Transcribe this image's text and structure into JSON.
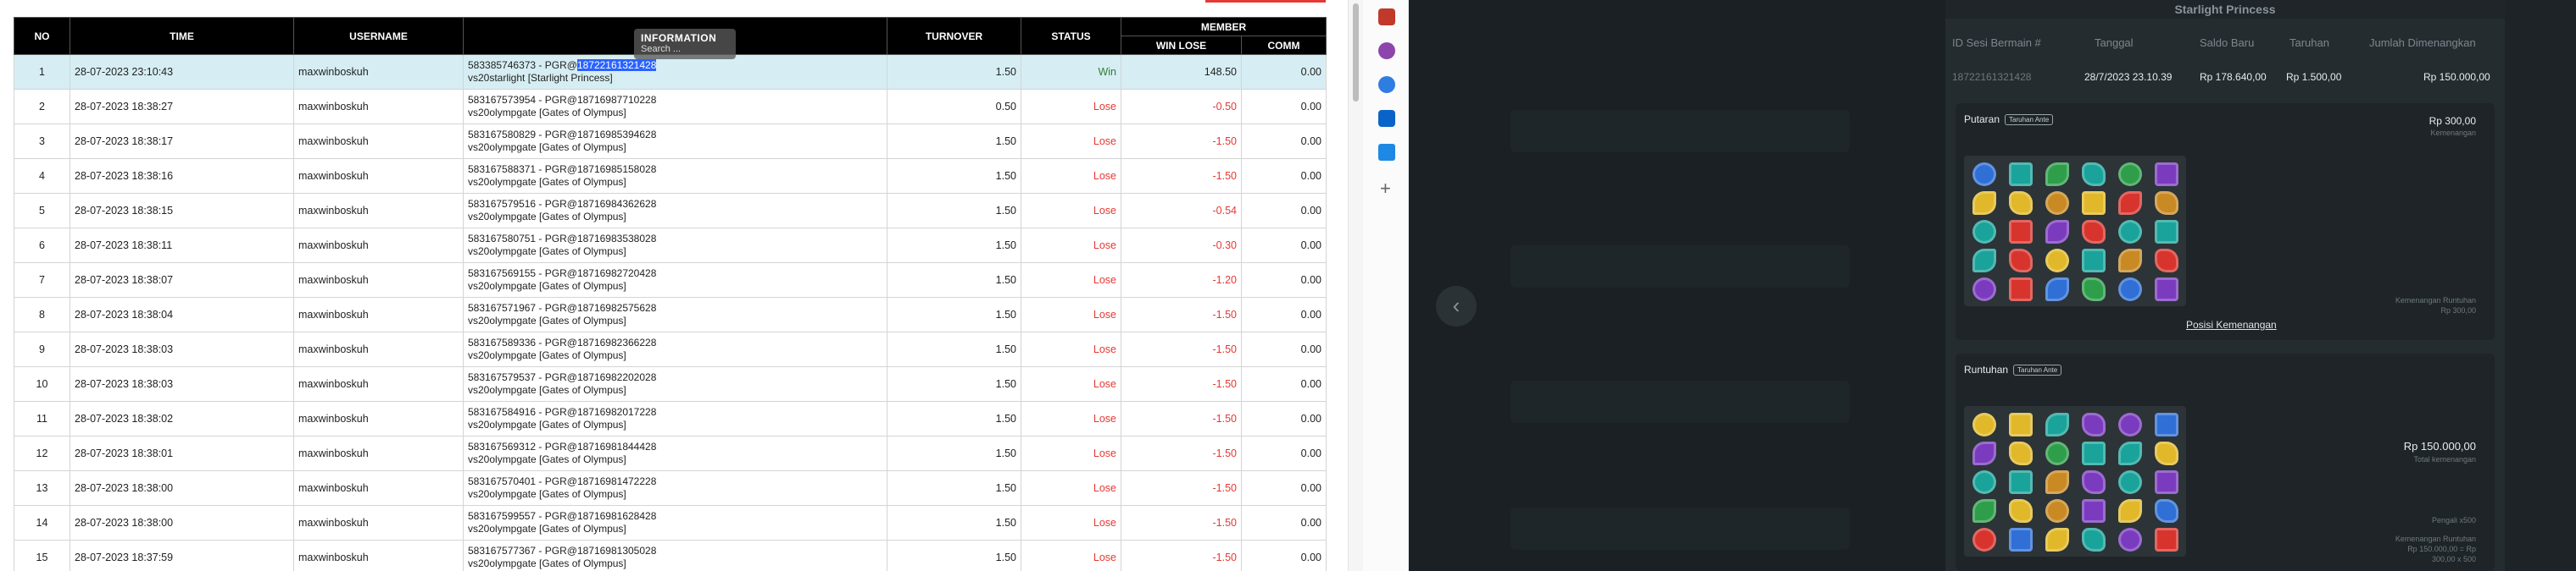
{
  "table": {
    "headers": {
      "no": "NO",
      "time": "TIME",
      "username": "USERNAME",
      "information": "INFORMATION",
      "turnover": "TURNOVER",
      "status": "STATUS",
      "member": "MEMBER",
      "win_lose": "WIN LOSE",
      "comm": "COMM"
    },
    "selected_text": "18722161321428",
    "rows": [
      {
        "no": "1",
        "time": "28-07-2023 23:10:43",
        "username": "maxwinboskuh",
        "info_prefix": "583385746373 - PGR@",
        "info_id": "18722161321428",
        "info_game": "vs20starlight [Starlight Princess]",
        "turnover": "1.50",
        "status": "Win",
        "win_lose": "148.50",
        "comm": "0.00"
      },
      {
        "no": "2",
        "time": "28-07-2023 18:38:27",
        "username": "maxwinboskuh",
        "info_prefix": "583167573954 - PGR@",
        "info_id": "18716987710228",
        "info_game": "vs20olympgate [Gates of Olympus]",
        "turnover": "0.50",
        "status": "Lose",
        "win_lose": "-0.50",
        "comm": "0.00"
      },
      {
        "no": "3",
        "time": "28-07-2023 18:38:17",
        "username": "maxwinboskuh",
        "info_prefix": "583167580829 - PGR@",
        "info_id": "18716985394628",
        "info_game": "vs20olympgate [Gates of Olympus]",
        "turnover": "1.50",
        "status": "Lose",
        "win_lose": "-1.50",
        "comm": "0.00"
      },
      {
        "no": "4",
        "time": "28-07-2023 18:38:16",
        "username": "maxwinboskuh",
        "info_prefix": "583167588371 - PGR@",
        "info_id": "18716985158028",
        "info_game": "vs20olympgate [Gates of Olympus]",
        "turnover": "1.50",
        "status": "Lose",
        "win_lose": "-1.50",
        "comm": "0.00"
      },
      {
        "no": "5",
        "time": "28-07-2023 18:38:15",
        "username": "maxwinboskuh",
        "info_prefix": "583167579516 - PGR@",
        "info_id": "18716984362628",
        "info_game": "vs20olympgate [Gates of Olympus]",
        "turnover": "1.50",
        "status": "Lose",
        "win_lose": "-0.54",
        "comm": "0.00"
      },
      {
        "no": "6",
        "time": "28-07-2023 18:38:11",
        "username": "maxwinboskuh",
        "info_prefix": "583167580751 - PGR@",
        "info_id": "18716983538028",
        "info_game": "vs20olympgate [Gates of Olympus]",
        "turnover": "1.50",
        "status": "Lose",
        "win_lose": "-0.30",
        "comm": "0.00"
      },
      {
        "no": "7",
        "time": "28-07-2023 18:38:07",
        "username": "maxwinboskuh",
        "info_prefix": "583167569155 - PGR@",
        "info_id": "18716982720428",
        "info_game": "vs20olympgate [Gates of Olympus]",
        "turnover": "1.50",
        "status": "Lose",
        "win_lose": "-1.20",
        "comm": "0.00"
      },
      {
        "no": "8",
        "time": "28-07-2023 18:38:04",
        "username": "maxwinboskuh",
        "info_prefix": "583167571967 - PGR@",
        "info_id": "18716982575628",
        "info_game": "vs20olympgate [Gates of Olympus]",
        "turnover": "1.50",
        "status": "Lose",
        "win_lose": "-1.50",
        "comm": "0.00"
      },
      {
        "no": "9",
        "time": "28-07-2023 18:38:03",
        "username": "maxwinboskuh",
        "info_prefix": "583167589336 - PGR@",
        "info_id": "18716982366228",
        "info_game": "vs20olympgate [Gates of Olympus]",
        "turnover": "1.50",
        "status": "Lose",
        "win_lose": "-1.50",
        "comm": "0.00"
      },
      {
        "no": "10",
        "time": "28-07-2023 18:38:03",
        "username": "maxwinboskuh",
        "info_prefix": "583167579537 - PGR@",
        "info_id": "18716982202028",
        "info_game": "vs20olympgate [Gates of Olympus]",
        "turnover": "1.50",
        "status": "Lose",
        "win_lose": "-1.50",
        "comm": "0.00"
      },
      {
        "no": "11",
        "time": "28-07-2023 18:38:02",
        "username": "maxwinboskuh",
        "info_prefix": "583167584916 - PGR@",
        "info_id": "18716982017228",
        "info_game": "vs20olympgate [Gates of Olympus]",
        "turnover": "1.50",
        "status": "Lose",
        "win_lose": "-1.50",
        "comm": "0.00"
      },
      {
        "no": "12",
        "time": "28-07-2023 18:38:01",
        "username": "maxwinboskuh",
        "info_prefix": "583167569312 - PGR@",
        "info_id": "18716981844428",
        "info_game": "vs20olympgate [Gates of Olympus]",
        "turnover": "1.50",
        "status": "Lose",
        "win_lose": "-1.50",
        "comm": "0.00"
      },
      {
        "no": "13",
        "time": "28-07-2023 18:38:00",
        "username": "maxwinboskuh",
        "info_prefix": "583167570401 - PGR@",
        "info_id": "18716981472228",
        "info_game": "vs20olympgate [Gates of Olympus]",
        "turnover": "1.50",
        "status": "Lose",
        "win_lose": "-1.50",
        "comm": "0.00"
      },
      {
        "no": "14",
        "time": "28-07-2023 18:38:00",
        "username": "maxwinboskuh",
        "info_prefix": "583167599557 - PGR@",
        "info_id": "18716981628428",
        "info_game": "vs20olympgate [Gates of Olympus]",
        "turnover": "1.50",
        "status": "Lose",
        "win_lose": "-1.50",
        "comm": "0.00"
      },
      {
        "no": "15",
        "time": "28-07-2023 18:37:59",
        "username": "maxwinboskuh",
        "info_prefix": "583167577367 - PGR@",
        "info_id": "18716981305028",
        "info_game": "vs20olympgate [Gates of Olympus]",
        "turnover": "1.50",
        "status": "Lose",
        "win_lose": "-1.50",
        "comm": "0.00"
      }
    ]
  },
  "tooltip": {
    "title": "INFORMATION",
    "search": "Search   ..."
  },
  "colors": {
    "win": "#2e7d32",
    "lose": "#e53935",
    "header_bg": "#000000",
    "highlight_row": "#d6eef3",
    "selection": "#2962ff",
    "dark_bg": "#1d2327"
  },
  "sidebar_icons": [
    "gift-icon",
    "user-icon",
    "copilot-icon",
    "outlook-icon",
    "shopping-icon",
    "add-icon"
  ],
  "detail": {
    "title": "Starlight Princess",
    "columns": [
      "ID Sesi Bermain #",
      "Tanggal",
      "Saldo Baru",
      "Taruhan",
      "Jumlah Dimenangkan"
    ],
    "session_id": "18722161321428",
    "date": "28/7/2023 23.10.39",
    "saldo_baru": "Rp 178.640,00",
    "taruhan": "Rp 1.500,00",
    "jumlah": "Rp 150.000,00",
    "putaran": {
      "label": "Putaran",
      "tag": "Taruhan Ante",
      "amount": "Rp 300,00",
      "amount_sub": "Kemenangan",
      "cascade_label": "Kemenangan Runtuhan",
      "cascade_value": "Rp 300,00"
    },
    "posisi_link": "Posisi Kemenangan",
    "runtuhan": {
      "label": "Runtuhan",
      "tag": "Taruhan Ante",
      "amount": "Rp 150.000,00",
      "amount_sub": "Total kemenangan",
      "pengali": "Pengali x500",
      "cascade_label": "Kemenangan Runtuhan",
      "cascade_value": "Rp 150.000,00 = Rp",
      "cascade_value2": "300,00 x 500"
    }
  }
}
